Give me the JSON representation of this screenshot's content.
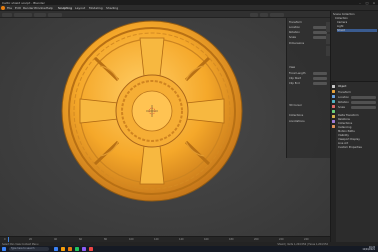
{
  "window": {
    "title": "Celtic shield sculpt - Blender",
    "controls": [
      "–",
      "□",
      "×"
    ]
  },
  "menu": {
    "items": [
      "File",
      "Edit",
      "Render",
      "Window",
      "Help",
      "Sculpting",
      "Layout",
      "Modeling",
      "Shading"
    ]
  },
  "npanel": {
    "rows": [
      "Transform",
      "Location",
      "Rotation",
      "Scale",
      "Dimensions",
      "View",
      "Focal Length",
      "Clip Start",
      "Clip End",
      "3D Cursor",
      "Collections",
      "Annotations"
    ]
  },
  "outliner": {
    "rows": [
      "Scene Collection",
      "Collection",
      "Camera",
      "Light",
      "Shield"
    ],
    "selected_index": 4
  },
  "properties": {
    "rows": [
      "Object",
      "Transform",
      "Location",
      "Rotation",
      "Scale",
      "Delta Transform",
      "Relations",
      "Collections",
      "Instancing",
      "Motion Paths",
      "Visibility",
      "Viewport Display",
      "Line Art",
      "Custom Properties"
    ],
    "tab_colors": [
      "#c9c9c9",
      "#e8a23a",
      "#6aa2e0",
      "#4fb3c2",
      "#e06a6a",
      "#6ad07a",
      "#d7b24a",
      "#a07ad7",
      "#e0905a"
    ]
  },
  "timeline": {
    "ticks": [
      "0",
      "20",
      "40",
      "60",
      "80",
      "100",
      "120",
      "140",
      "160",
      "180",
      "200",
      "220",
      "240"
    ]
  },
  "statusbar": {
    "left": "Select   Pan View   Context Menu",
    "right": "Shield | Verts 1,204,556 | Faces 1,204,552"
  },
  "taskbar": {
    "search_placeholder": "Type here to search",
    "time": "10:24",
    "date": "12/04/2021",
    "icon_colors": [
      "#3b82f6",
      "#f59e0b",
      "#e87d0d",
      "#22c55e",
      "#8b5cf6",
      "#ef4444"
    ]
  },
  "colors": {
    "shield_light": "#ffce66",
    "shield_mid": "#f5a82a",
    "shield_dark": "#c7781a",
    "accent_blue": "#3f7fd6"
  }
}
